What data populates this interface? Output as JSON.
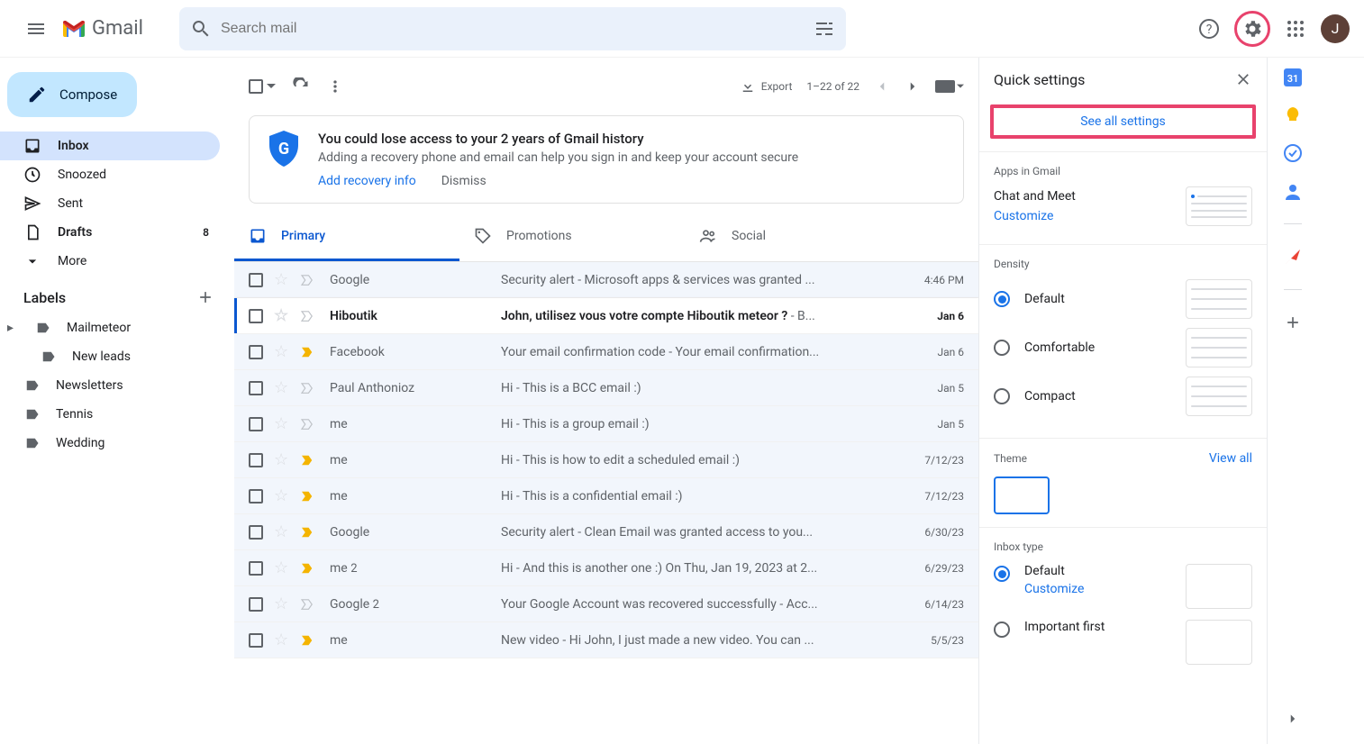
{
  "header": {
    "app_name": "Gmail",
    "search_placeholder": "Search mail",
    "avatar_letter": "J"
  },
  "sidebar": {
    "compose": "Compose",
    "nav": [
      {
        "label": "Inbox",
        "icon": "inbox",
        "active": true
      },
      {
        "label": "Snoozed",
        "icon": "clock"
      },
      {
        "label": "Sent",
        "icon": "send"
      },
      {
        "label": "Drafts",
        "icon": "file",
        "count": "8",
        "bold": true
      },
      {
        "label": "More",
        "icon": "chevron-down"
      }
    ],
    "labels_title": "Labels",
    "labels": [
      {
        "label": "Mailmeteor",
        "caret": true
      },
      {
        "label": "New leads",
        "child": true
      },
      {
        "label": "Newsletters"
      },
      {
        "label": "Tennis"
      },
      {
        "label": "Wedding"
      }
    ]
  },
  "toolbar": {
    "export": "Export",
    "range": "1–22 of 22"
  },
  "banner": {
    "title": "You could lose access to your 2 years of Gmail history",
    "sub": "Adding a recovery phone and email can help you sign in and keep your account secure",
    "add": "Add recovery info",
    "dismiss": "Dismiss"
  },
  "tabs": [
    {
      "label": "Primary",
      "icon": "inbox",
      "active": true
    },
    {
      "label": "Promotions",
      "icon": "tag"
    },
    {
      "label": "Social",
      "icon": "people"
    }
  ],
  "emails": [
    {
      "sender": "Google",
      "subject": "Security alert",
      "snippet": " - Microsoft apps & services was granted ...",
      "date": "4:46 PM",
      "read": true,
      "important": false
    },
    {
      "sender": "Hiboutik",
      "subject": "John, utilisez vous votre compte Hiboutik meteor ?",
      "snippet": " - B...",
      "date": "Jan 6",
      "read": false,
      "important": false,
      "hover": true
    },
    {
      "sender": "Facebook",
      "subject": "Your email confirmation code",
      "snippet": " - Your email confirmation...",
      "date": "Jan 6",
      "read": true,
      "important": true
    },
    {
      "sender": "Paul Anthonioz",
      "subject": "Hi",
      "snippet": " - This is a BCC email :)",
      "date": "Jan 5",
      "read": true,
      "important": false
    },
    {
      "sender": "me",
      "subject": "Hi",
      "snippet": " - This is a group email :)",
      "date": "Jan 5",
      "read": true,
      "important": false
    },
    {
      "sender": "me",
      "subject": "Hi",
      "snippet": " - This is how to edit a scheduled email :)",
      "date": "7/12/23",
      "read": true,
      "important": true
    },
    {
      "sender": "me",
      "subject": "Hi",
      "snippet": " - This is a confidential email :)",
      "date": "7/12/23",
      "read": true,
      "important": true
    },
    {
      "sender": "Google",
      "subject": "Security alert",
      "snippet": " - Clean Email was granted access to you...",
      "date": "6/30/23",
      "read": true,
      "important": true
    },
    {
      "sender": "me",
      "thread": "2",
      "subject": "Hi",
      "snippet": " - And this is another one :) On Thu, Jan 19, 2023 at 2...",
      "date": "6/29/23",
      "read": true,
      "important": true
    },
    {
      "sender": "Google",
      "thread": "2",
      "subject": "Your Google Account was recovered successfully",
      "snippet": " - Acc...",
      "date": "6/14/23",
      "read": true,
      "important": false
    },
    {
      "sender": "me",
      "subject": "New video",
      "snippet": " - Hi John, I just made a new video. You can ...",
      "date": "5/5/23",
      "read": true,
      "important": true
    }
  ],
  "settings": {
    "title": "Quick settings",
    "see_all": "See all settings",
    "apps_title": "Apps in Gmail",
    "chat_meet": "Chat and Meet",
    "customize": "Customize",
    "density_title": "Density",
    "density": [
      {
        "label": "Default",
        "checked": true
      },
      {
        "label": "Comfortable"
      },
      {
        "label": "Compact"
      }
    ],
    "theme_title": "Theme",
    "view_all": "View all",
    "inbox_title": "Inbox type",
    "inbox": [
      {
        "label": "Default",
        "checked": true,
        "customize": true
      },
      {
        "label": "Important first"
      }
    ]
  }
}
